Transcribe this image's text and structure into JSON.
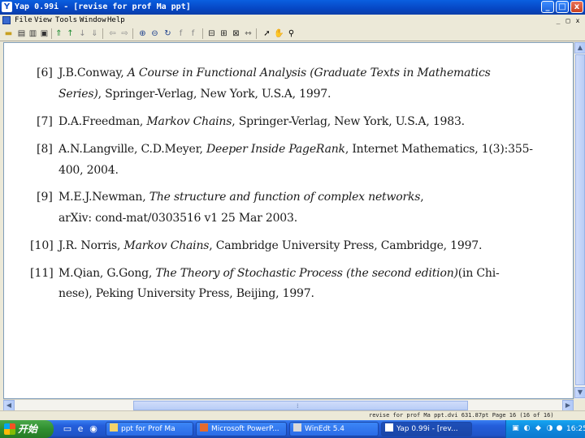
{
  "window": {
    "app_icon": "Y",
    "title": "Yap 0.99i - [revise for prof Ma ppt]",
    "buttons": {
      "minimize": "_",
      "maximize": "□",
      "close": "x"
    }
  },
  "menu": {
    "items": [
      "File",
      "View",
      "Tools",
      "Window",
      "Help"
    ],
    "mdi_buttons": {
      "minimize": "_",
      "restore": "□",
      "close": "x"
    }
  },
  "toolbar": {
    "icons": [
      "open-icon",
      "print-icon",
      "print-setup-icon",
      "page-setup-icon",
      "first-page-icon",
      "prev-page-icon",
      "next-page-icon",
      "last-page-icon",
      "back-icon",
      "forward-icon",
      "zoom-in-icon",
      "zoom-out-icon",
      "refresh-icon",
      "font-icon",
      "font-select-icon",
      "fit-page-icon",
      "fit-width-icon",
      "two-page-icon",
      "ruler-icon",
      "select-icon",
      "hand-icon",
      "magnify-icon"
    ]
  },
  "references": [
    {
      "number": "[6]",
      "lines": [
        {
          "pre": "J.B.Conway, ",
          "ital": "A Course in Functional Analysis (Graduate Texts in Mathematics",
          "post": ""
        },
        {
          "pre": "",
          "ital": "Series)",
          "post": ", Springer-Verlag, New York, U.S.A, 1997."
        }
      ]
    },
    {
      "number": "[7]",
      "lines": [
        {
          "pre": "D.A.Freedman, ",
          "ital": "Markov Chains",
          "post": ", Springer-Verlag, New York, U.S.A, 1983."
        }
      ]
    },
    {
      "number": "[8]",
      "lines": [
        {
          "pre": "A.N.Langville, C.D.Meyer, ",
          "ital": "Deeper Inside PageRank",
          "post": ", Internet Mathematics, 1(3):355-"
        },
        {
          "pre": "400, 2004.",
          "ital": "",
          "post": ""
        }
      ]
    },
    {
      "number": "[9]",
      "lines": [
        {
          "pre": "M.E.J.Newman, ",
          "ital": "The structure and function of complex networks",
          "post": ","
        },
        {
          "pre": "arXiv: cond-mat/0303516 v1 25 Mar 2003.",
          "ital": "",
          "post": ""
        }
      ]
    },
    {
      "number": "[10]",
      "lines": [
        {
          "pre": "J.R. Norris, ",
          "ital": "Markov Chains",
          "post": ", Cambridge University Press, Cambridge, 1997."
        }
      ]
    },
    {
      "number": "[11]",
      "lines": [
        {
          "pre": "M.Qian, G.Gong, ",
          "ital": "The Theory of Stochastic Process (the second edition)",
          "post": "(in Chi-"
        },
        {
          "pre": "nese), Peking University Press, Beijing, 1997.",
          "ital": "",
          "post": ""
        }
      ]
    }
  ],
  "status": {
    "text": "revise for prof Ma ppt.dvi  631.87pt  Page 16 (16 of 16)"
  },
  "taskbar": {
    "start_label": "开始",
    "tasks": [
      {
        "label": "ppt for Prof Ma",
        "active": false
      },
      {
        "label": "Microsoft PowerP...",
        "active": false
      },
      {
        "label": "WinEdt 5.4",
        "active": false
      },
      {
        "label": "Yap 0.99i - [rev...",
        "active": true
      }
    ],
    "clock": "16:25"
  },
  "colors": {
    "titlebar": "#0646c4",
    "taskbar": "#245edb",
    "start": "#2f8f2f",
    "tray": "#0f8bdf"
  }
}
